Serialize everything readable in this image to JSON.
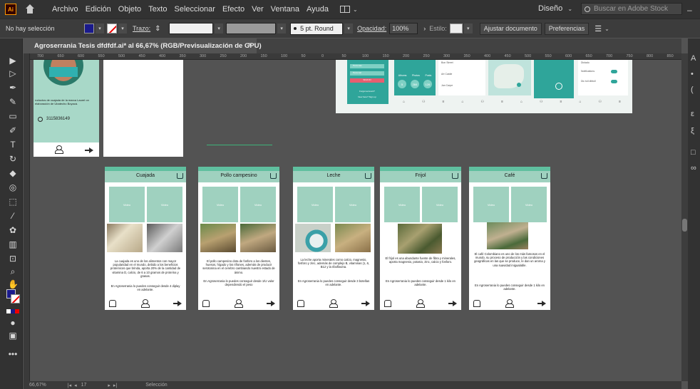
{
  "menubar": {
    "logo": "Ai",
    "items": [
      "Archivo",
      "Edición",
      "Objeto",
      "Texto",
      "Seleccionar",
      "Efecto",
      "Ver",
      "Ventana",
      "Ayuda"
    ],
    "workspace": "Diseño",
    "stock_placeholder": "Buscar en Adobe Stock"
  },
  "controlbar": {
    "selection": "No hay selección",
    "stroke_label": "Trazo:",
    "brush": "5 pt. Round",
    "opacity_label": "Opacidad:",
    "opacity_value": "100%",
    "style_label": "Estilo:",
    "adjust_button": "Ajustar documento",
    "prefs_button": "Preferencias",
    "fill_color": "#1a1a8c"
  },
  "document": {
    "tab_title": "Agroserrania Tesis dfdfdf.ai* al 66,67% (RGB/Previsualización de GPU)",
    "close": "×"
  },
  "ruler_ticks": [
    "700",
    "650",
    "600",
    "550",
    "500",
    "450",
    "400",
    "350",
    "300",
    "250",
    "200",
    "150",
    "100",
    "50",
    "0",
    "50",
    "100",
    "150",
    "200",
    "250",
    "300",
    "350",
    "400",
    "450",
    "500",
    "550",
    "600",
    "650",
    "700",
    "750",
    "800",
    "850"
  ],
  "artboard_contact": {
    "desc": "roductos de cuajada de la marca Laurel on elaboración de Ubatecho Boyacá.",
    "phone": "3115836149"
  },
  "products": [
    {
      "title": "Cuajada",
      "video1": "Video",
      "video2": "Video",
      "desc": "La cuajada es uno de los alimentos con mayor popularidad en el mundo, debido a los beneficios proteínicos que brinda, aporta 20% de la cantidad de vitamina D, calcio, de 6 a 10 gramos de proteína y grasas.",
      "availability": "En Agroserrania lo puedes conseguir desde 4 diplay en adelante."
    },
    {
      "title": "Pollo campesino",
      "video1": "Video",
      "video2": "Video",
      "desc": "El pollo campesino dota de fosforo a los dientes, huesos, hígado y los riñones, además de producir serotonina en el cerebro cambiando nuestro estado de ánimo.",
      "availability": "En Agroserrania lo puedes conseguir desde 1/U valor dependiendo el peso"
    },
    {
      "title": "Leche",
      "video1": "Video",
      "video2": "Video",
      "desc": "La leche aporta minerales como calcio, magnesio, fosforo y zinc, además de complejo B, vitaminas (1, 6, B12 y la riboflavina.",
      "availability": "En Agroserrania lo puedes conseguir desde 3 botellas en adelante."
    },
    {
      "title": "Frijol",
      "video1": "Video",
      "video2": "Video",
      "desc": "El frijol es una abundante fuente de fibra y minerales, aporta magnesio, potasio, zinc, calcio y fosforo.",
      "availability": "En Agroserrania lo puedes conseguir desde 1 kilo en adelante."
    },
    {
      "title": "Café",
      "video1": "Video",
      "video2": "Video",
      "desc": "El café Colombiano es uno de los más famosos en el mundo, su proceso de producción y las condiciones geográficas en las que se produce, le dan un aroma y una suavidad inigualable.",
      "availability": "En Agroserrania lo puedes conseguir desde 1 kilo en adelante."
    }
  ],
  "topright_board": {
    "col1": [
      "Personas",
      "Personal",
      "SIGN IN",
      "Forgot account?",
      "New here? Sign up"
    ],
    "stats_labels": [
      "Albums",
      "Photos",
      "Posts"
    ],
    "stats_values": [
      "5",
      "284",
      "126"
    ],
    "list": [
      "Bon Street",
      "Art Castle",
      "Jan Carpe"
    ],
    "settings": [
      "Dictado",
      "Notifications",
      "Dic toil dibtoll"
    ]
  },
  "statusbar": {
    "zoom": "66,67%",
    "page": "17",
    "tool": "Selección"
  },
  "colors": {
    "accent": "#5fbf9f",
    "header": "#9fd1bf",
    "teal_dark": "#2fa59a"
  }
}
